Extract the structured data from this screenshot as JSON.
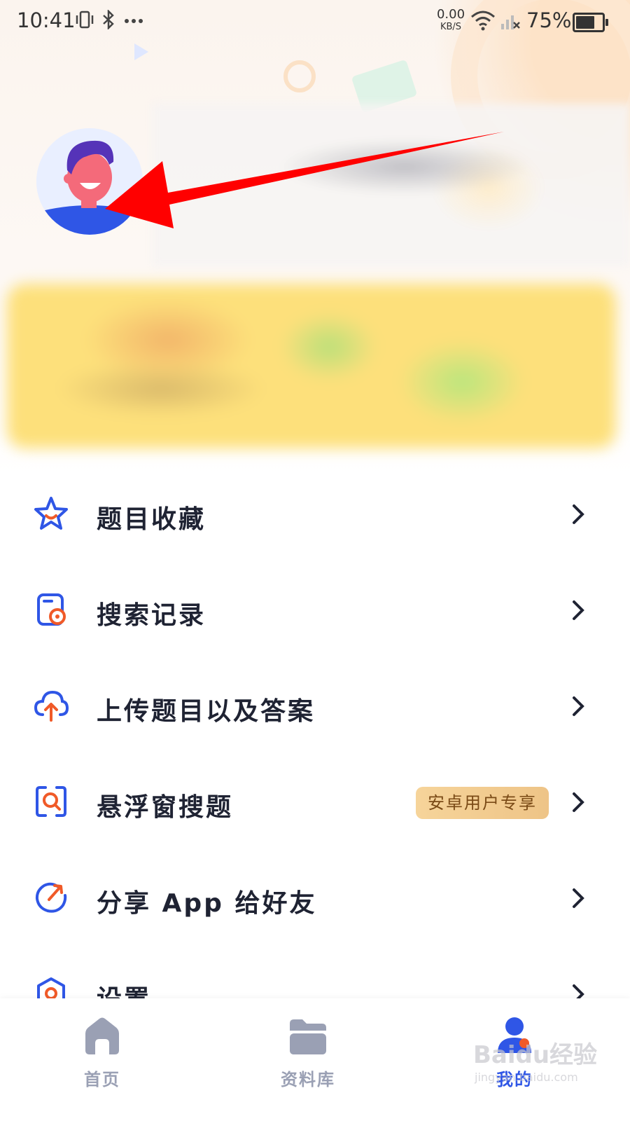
{
  "status_bar": {
    "time": "10:41",
    "network_speed": "0.00",
    "network_unit": "KB/S",
    "battery_percent": "75%",
    "battery_level": 0.75
  },
  "menu": {
    "items": [
      {
        "label": "题目收藏",
        "icon": "star-icon"
      },
      {
        "label": "搜索记录",
        "icon": "search-history-icon"
      },
      {
        "label": "上传题目以及答案",
        "icon": "upload-cloud-icon"
      },
      {
        "label": "悬浮窗搜题",
        "icon": "floating-search-icon",
        "badge": "安卓用户专享"
      },
      {
        "label": "分享 App 给好友",
        "icon": "share-icon"
      },
      {
        "label": "设置",
        "icon": "settings-icon"
      }
    ]
  },
  "tabbar": {
    "tabs": [
      {
        "label": "首页",
        "icon": "home-icon"
      },
      {
        "label": "资料库",
        "icon": "folder-icon"
      },
      {
        "label": "我的",
        "icon": "profile-icon",
        "active": true
      }
    ]
  },
  "watermark": {
    "text": "Baidu经验",
    "sub": "jingyan.baidu.com"
  },
  "colors": {
    "accent": "#2f56e6",
    "icon_orange": "#f05a28",
    "badge_bg": "#f1ca8e",
    "arrow": "#ff0000"
  }
}
